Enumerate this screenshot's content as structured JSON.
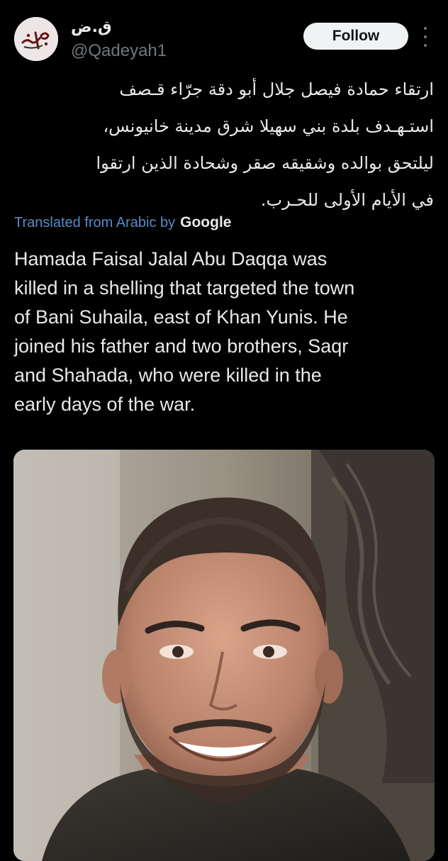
{
  "post": {
    "author": {
      "display_name": "ق.ض",
      "handle": "@Qadeyah1",
      "avatar_icon": "calligraphy-logo-avatar"
    },
    "follow_label": "Follow",
    "more_icon": "more-vertical-icon",
    "original_text": "ارتقاء حمادة فيصل جلال أبو دقة جرّاء قـصف\nاستـهـدف بلدة بني سهيلا شرق مدينة خانيونس،\nليلتحق بوالده وشقيقه صقر وشحادة الذين ارتقوا\nفي الأيام الأولى للحـرب.",
    "translation": {
      "label": "Translated from Arabic by",
      "provider": "Google"
    },
    "translated_text": "Hamada Faisal Jalal Abu Daqqa was\nkilled in a shelling that targeted the town\nof Bani Suhaila, east of Khan Yunis. He\njoined his father and two brothers, Saqr\nand Shahada, who were killed in the\nearly days of the war.",
    "media": {
      "type": "photo",
      "subject": "portrait-photo"
    }
  },
  "colors": {
    "background": "#000000",
    "text_primary": "#e7e9ea",
    "text_secondary": "#71767b",
    "link": "#5a8bc2",
    "follow_bg": "#eff3f4",
    "follow_text": "#0f1419"
  }
}
